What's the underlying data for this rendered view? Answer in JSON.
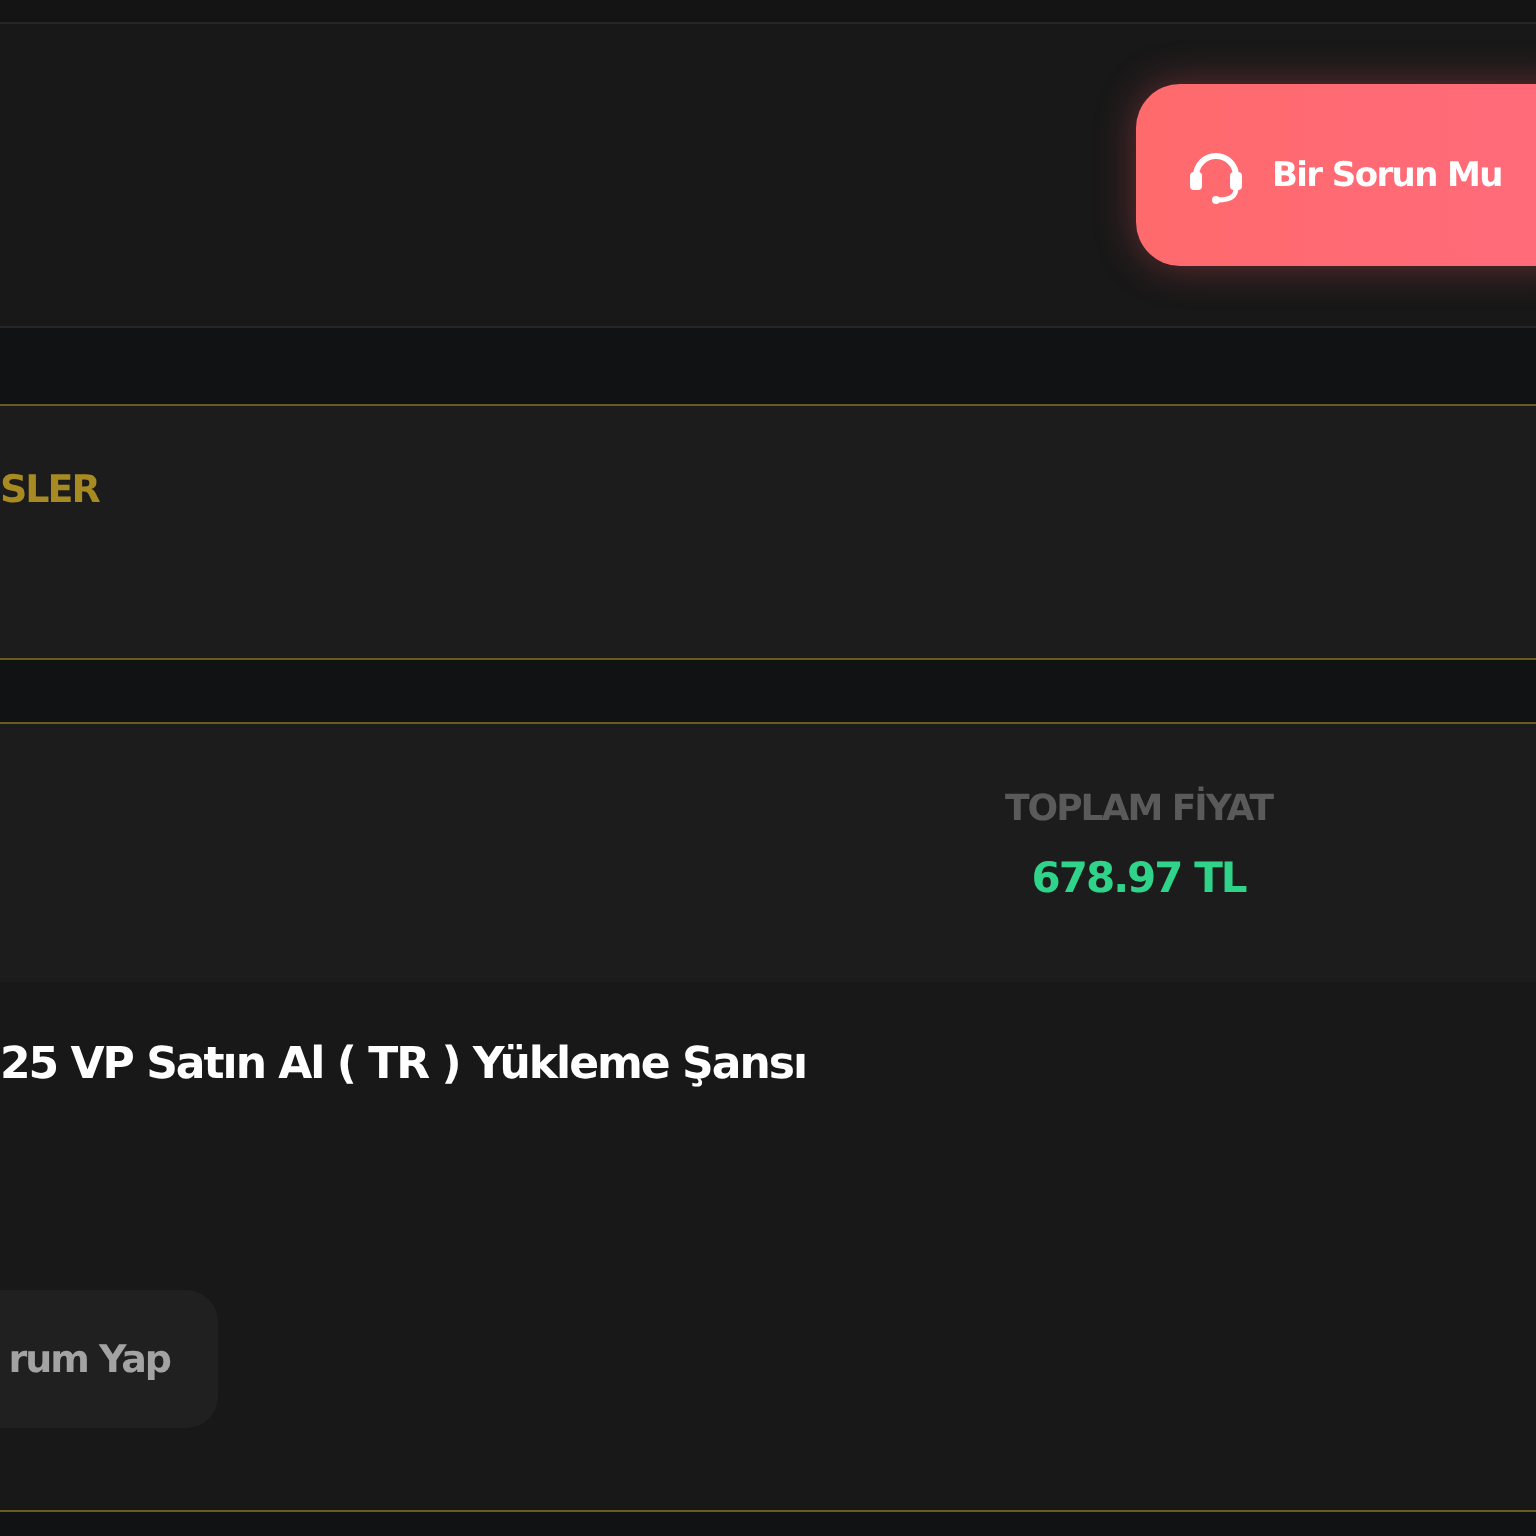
{
  "header": {
    "support_button": "Bir Sorun Mu"
  },
  "section_title": "SLER",
  "order": {
    "total_label": "TOPLAM FİYAT",
    "total_value": "678.97 TL",
    "product_title": "25 VP Satın Al ( TR ) Yükleme Şansı",
    "review_button": "rum Yap"
  }
}
